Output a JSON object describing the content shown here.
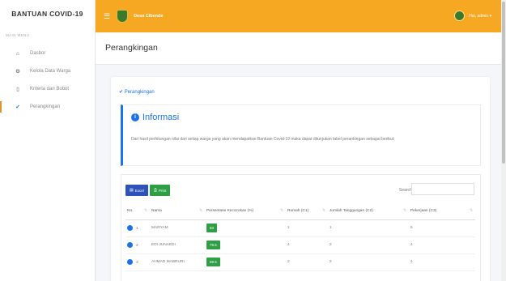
{
  "sidebar": {
    "brand": "BANTUAN COVID-19",
    "heading": "MAIN MENU",
    "items": [
      {
        "icon": "⌂",
        "label": "Dasbor"
      },
      {
        "icon": "⚙",
        "label": "Kelola Data Warga"
      },
      {
        "icon": "▯",
        "label": "Kriteria dan Bobot"
      },
      {
        "icon": "✔",
        "label": "Perangkingan"
      }
    ]
  },
  "topbar": {
    "app_name": "Desa Cibende",
    "user": "Hai, admin ▾",
    "color": "#f7a823"
  },
  "page": {
    "title": "Perangkingan",
    "breadcrumb": "✔ Perangkingan"
  },
  "info": {
    "title": "Informasi",
    "text": "Dari hasil perhitungan nilai dari setiap warga yang akan mendapatkan Bantuan Covid-19 maka dapat ditunjukan tabel perankingan sebagai berikut:"
  },
  "table": {
    "excel_label": "Excel",
    "print_label": "Print",
    "search_label": "Search:",
    "columns": [
      "No.",
      "Nama",
      "Persentase Kecocokan (%)",
      "Rumah (C1)",
      "Jumlah Tanggungan (C2)",
      "Pekerjaan (C3)"
    ],
    "rows": [
      {
        "no": "1",
        "nama": "MARYAM",
        "persen": "83",
        "c1": "1",
        "c2": "1",
        "c3": "5"
      },
      {
        "no": "2",
        "nama": "EDI JUNAEDI",
        "persen": "79.5",
        "c1": "4",
        "c2": "2",
        "c3": "4"
      },
      {
        "no": "3",
        "nama": "AHMAD MABRURI",
        "persen": "69.5",
        "c1": "2",
        "c2": "2",
        "c3": "4"
      }
    ]
  }
}
